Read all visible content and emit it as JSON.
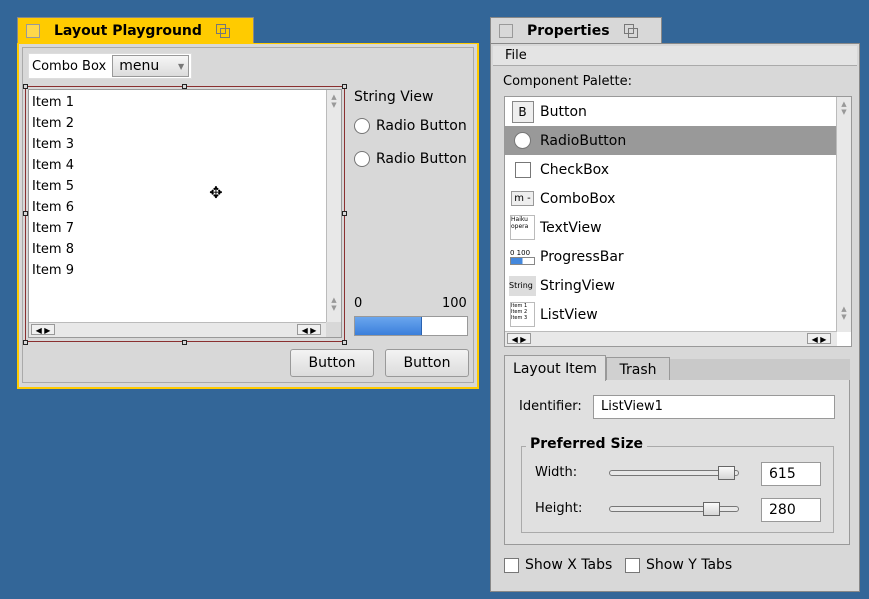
{
  "colors": {
    "desktop": "#336698",
    "tab_active": "#ffcb00",
    "tab_inactive": "#d8d8d8",
    "selection": "#999999",
    "progress": "#4488dd"
  },
  "playground": {
    "title": "Layout Playground",
    "combo_label": "Combo Box",
    "combo_value": "menu",
    "list_items": [
      "Item 1",
      "Item 2",
      "Item 3",
      "Item 4",
      "Item 5",
      "Item 6",
      "Item 7",
      "Item 8",
      "Item 9"
    ],
    "string_view": "String View",
    "radio1": "Radio Button",
    "radio2": "Radio Button",
    "progress_min": "0",
    "progress_max": "100",
    "progress_value": 60,
    "button1": "Button",
    "button2": "Button",
    "move_icon": "move-cursor-icon"
  },
  "properties": {
    "title": "Properties",
    "menu_file": "File",
    "palette_label": "Component Palette:",
    "palette_items": [
      {
        "label": "Button",
        "icon": "B"
      },
      {
        "label": "RadioButton",
        "icon": ""
      },
      {
        "label": "CheckBox",
        "icon": ""
      },
      {
        "label": "ComboBox",
        "icon": "m -"
      },
      {
        "label": "TextView",
        "icon": "Haiku opera"
      },
      {
        "label": "ProgressBar",
        "icon": "0 100"
      },
      {
        "label": "StringView",
        "icon": "String"
      },
      {
        "label": "ListView",
        "icon": "Item 1 Item 2"
      }
    ],
    "selected_index": 1,
    "tab_layout": "Layout Item",
    "tab_trash": "Trash",
    "identifier_label": "Identifier:",
    "identifier_value": "ListView1",
    "preferred_size_label": "Preferred Size",
    "width_label": "Width:",
    "width_value": "615",
    "height_label": "Height:",
    "height_value": "280",
    "show_x_tabs": "Show X Tabs",
    "show_y_tabs": "Show Y Tabs"
  }
}
